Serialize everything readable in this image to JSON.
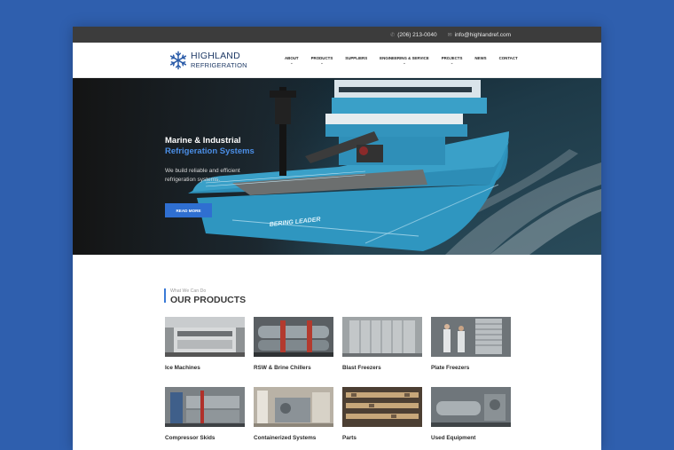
{
  "topbar": {
    "phone": "(206) 213-0040",
    "email": "info@highlandref.com",
    "phone_icon": "phone-icon",
    "email_icon": "mail-icon"
  },
  "header": {
    "logo_line1": "HIGHLAND",
    "logo_line2": "REFRIGERATION",
    "logo_icon": "snowflake-icon",
    "nav": [
      {
        "label": "ABOUT",
        "has_dropdown": true
      },
      {
        "label": "PRODUCTS",
        "has_dropdown": true
      },
      {
        "label": "SUPPLIERS",
        "has_dropdown": false
      },
      {
        "label": "ENGINEERING & SERVICE",
        "has_dropdown": true
      },
      {
        "label": "PROJECTS",
        "has_dropdown": true
      },
      {
        "label": "NEWS",
        "has_dropdown": false
      },
      {
        "label": "CONTACT",
        "has_dropdown": false
      }
    ]
  },
  "hero": {
    "title_line1": "Marine & Industrial",
    "title_line2": "Refrigeration Systems",
    "subtitle": "We build reliable and efficient refrigeration systems.",
    "button_label": "READ MORE",
    "ship_name": "BERING LEADER"
  },
  "products": {
    "eyebrow": "What We Can Do",
    "title": "OUR PRODUCTS",
    "items": [
      {
        "label": "Ice Machines"
      },
      {
        "label": "RSW & Brine Chillers"
      },
      {
        "label": "Blast Freezers"
      },
      {
        "label": "Plate Freezers"
      },
      {
        "label": "Compressor Skids"
      },
      {
        "label": "Containerized Systems"
      },
      {
        "label": "Parts"
      },
      {
        "label": "Used Equipment"
      }
    ]
  },
  "colors": {
    "background": "#2f5fae",
    "topbar": "#3c3c3c",
    "accent": "#2f6fd1",
    "accent_text": "#4b8ee6",
    "ship_hull": "#3aa0c8"
  }
}
